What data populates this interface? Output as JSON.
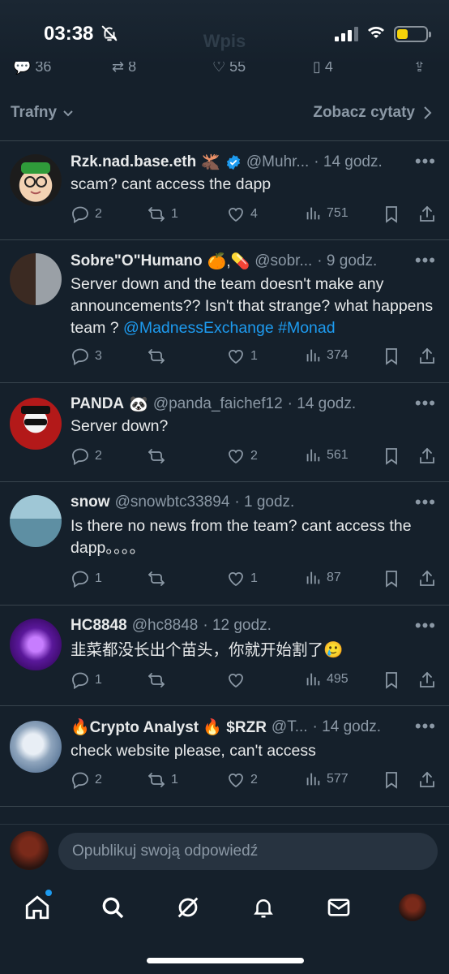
{
  "status_bar": {
    "time": "03:38"
  },
  "header": {
    "title_ghost": "Wpis"
  },
  "filter": {
    "sort_label": "Trafny",
    "quotes_label": "Zobacz cytaty"
  },
  "tweets": [
    {
      "name": "Rzk.nad.base.eth",
      "name_emoji": "🫎",
      "verified": true,
      "handle": "@Muhr...",
      "time": "· 14 godz.",
      "text": "scam? cant access the dapp",
      "replies": "2",
      "retweets": "1",
      "likes": "4",
      "views": "751"
    },
    {
      "name": "Sobre\"O\"Humano",
      "name_emoji": "🍊,💊",
      "handle": "@sobr...",
      "time": "· 9 godz.",
      "text": "Server down and the team doesn't make any announcements?? Isn't that strange? what happens team ?",
      "mention": "@MadnessExchange",
      "hashtag": "#Monad",
      "replies": "3",
      "retweets": "",
      "likes": "1",
      "views": "374"
    },
    {
      "name": "PANDA",
      "name_emoji": "🐼",
      "handle": "@panda_faichef12",
      "time": "· 14 godz.",
      "text": "Server down?",
      "replies": "2",
      "retweets": "",
      "likes": "2",
      "views": "561"
    },
    {
      "name": "snow",
      "handle": "@snowbtc33894",
      "time": "· 1 godz.",
      "text": "Is there no news from the team? cant access the dapp。。。。",
      "replies": "1",
      "retweets": "",
      "likes": "1",
      "views": "87"
    },
    {
      "name": "HC8848",
      "handle": "@hc8848",
      "time": "· 12 godz.",
      "text": "韭菜都没长出个苗头，你就开始割了🥲",
      "replies": "1",
      "retweets": "",
      "likes": "",
      "views": "495"
    },
    {
      "name": "🔥Crypto Analyst 🔥 $RZR",
      "handle": "@T...",
      "time": "· 14 godz.",
      "text": "check website please, can't access",
      "replies": "2",
      "retweets": "1",
      "likes": "2",
      "views": "577"
    }
  ],
  "reply_bar": {
    "placeholder": "Opublikuj swoją odpowiedź"
  },
  "colors": {
    "background": "#15202b",
    "accent": "#1d9bf0",
    "muted": "#8b98a5",
    "divider": "#38444d"
  }
}
